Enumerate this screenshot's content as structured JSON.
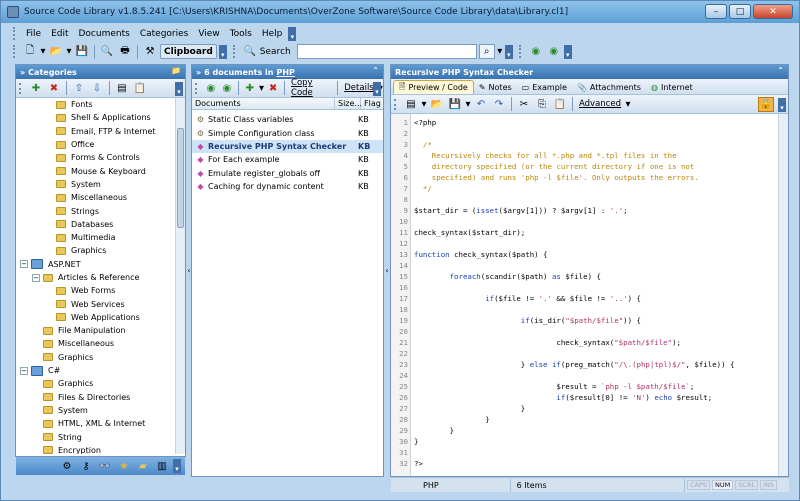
{
  "window": {
    "title": "Source Code Library v1.8.5.241 [C:\\Users\\KRISHNA\\Documents\\OverZone Software\\Source Code Library\\data\\Library.cl1]"
  },
  "menu": [
    "File",
    "Edit",
    "Documents",
    "Categories",
    "View",
    "Tools",
    "Help"
  ],
  "toolbar": {
    "clipboard_label": "Clipboard",
    "search_label": "Search",
    "search_value": ""
  },
  "categories": {
    "header": "Categories",
    "items": [
      {
        "label": "Fonts",
        "level": 2,
        "type": "folder"
      },
      {
        "label": "Shell & Applications",
        "level": 2,
        "type": "folder"
      },
      {
        "label": "Email, FTP & Internet",
        "level": 2,
        "type": "folder"
      },
      {
        "label": "Office",
        "level": 2,
        "type": "folder"
      },
      {
        "label": "Forms & Controls",
        "level": 2,
        "type": "folder"
      },
      {
        "label": "Mouse & Keyboard",
        "level": 2,
        "type": "folder"
      },
      {
        "label": "System",
        "level": 2,
        "type": "folder"
      },
      {
        "label": "Miscellaneous",
        "level": 2,
        "type": "folder"
      },
      {
        "label": "Strings",
        "level": 2,
        "type": "folder"
      },
      {
        "label": "Databases",
        "level": 2,
        "type": "folder"
      },
      {
        "label": "Multimedia",
        "level": 2,
        "type": "folder"
      },
      {
        "label": "Graphics",
        "level": 2,
        "type": "folder"
      },
      {
        "label": "ASP.NET",
        "level": 0,
        "type": "category"
      },
      {
        "label": "Articles & Reference",
        "level": 1,
        "type": "folder"
      },
      {
        "label": "Web Forms",
        "level": 2,
        "type": "folder"
      },
      {
        "label": "Web Services",
        "level": 2,
        "type": "folder"
      },
      {
        "label": "Web Applications",
        "level": 2,
        "type": "folder"
      },
      {
        "label": "File Manipulation",
        "level": 1,
        "type": "folder"
      },
      {
        "label": "Miscellaneous",
        "level": 1,
        "type": "folder"
      },
      {
        "label": "Graphics",
        "level": 1,
        "type": "folder"
      },
      {
        "label": "C#",
        "level": 0,
        "type": "category"
      },
      {
        "label": "Graphics",
        "level": 1,
        "type": "folder"
      },
      {
        "label": "Files & Directories",
        "level": 1,
        "type": "folder"
      },
      {
        "label": "System",
        "level": 1,
        "type": "folder"
      },
      {
        "label": "HTML, XML & Internet",
        "level": 1,
        "type": "folder"
      },
      {
        "label": "String",
        "level": 1,
        "type": "folder"
      },
      {
        "label": "Encryption",
        "level": 1,
        "type": "folder"
      }
    ]
  },
  "documents": {
    "header_count": "6 documents in",
    "header_cat": "PHP",
    "copy_code_label": "Copy Code",
    "details_label": "Details",
    "columns": [
      "Documents",
      "Size...",
      "Flag"
    ],
    "rows": [
      {
        "name": "Static Class variables",
        "size": "KB",
        "selected": false
      },
      {
        "name": "Simple Configuration class",
        "size": "KB",
        "selected": false
      },
      {
        "name": "Recursive PHP Syntax Checker",
        "size": "KB",
        "selected": true
      },
      {
        "name": "For Each example",
        "size": "KB",
        "selected": false
      },
      {
        "name": "Emulate register_globals off",
        "size": "KB",
        "selected": false
      },
      {
        "name": "Caching for dynamic content",
        "size": "KB",
        "selected": false
      }
    ]
  },
  "viewer": {
    "header": "Recursive PHP Syntax Checker",
    "tabs": [
      "Preview / Code",
      "Notes",
      "Example",
      "Attachments",
      "Internet"
    ],
    "advanced_label": "Advanced",
    "code_lines": [
      "<?php",
      "",
      "  /*",
      "    Recursively checks for all *.php and *.tpl files in the",
      "    directory specified (or the current directory if one is not",
      "    specified) and runs 'php -l $file'. Only outputs the errors.",
      "  */",
      "",
      "$start_dir = (isset($argv[1])) ? $argv[1] : '.';",
      "",
      "check_syntax($start_dir);",
      "",
      "function check_syntax($path) {",
      "",
      "        foreach(scandir($path) as $file) {",
      "",
      "                if($file != '.' && $file != '..') {",
      "",
      "                        if(is_dir(\"$path/$file\")) {",
      "",
      "                                check_syntax(\"$path/$file\");",
      "",
      "                        } else if(preg_match(\"/\\.(php|tpl)$/\", $file)) {",
      "",
      "                                $result = `php -l $path/$file`;",
      "                                if($result[0] != 'N') echo $result;",
      "                        }",
      "                }",
      "        }",
      "}",
      "",
      "?>"
    ]
  },
  "status": {
    "language": "PHP",
    "items": "6 Items",
    "caps": "CAPS",
    "num": "NUM",
    "scrl": "SCRL",
    "ins": "INS"
  }
}
